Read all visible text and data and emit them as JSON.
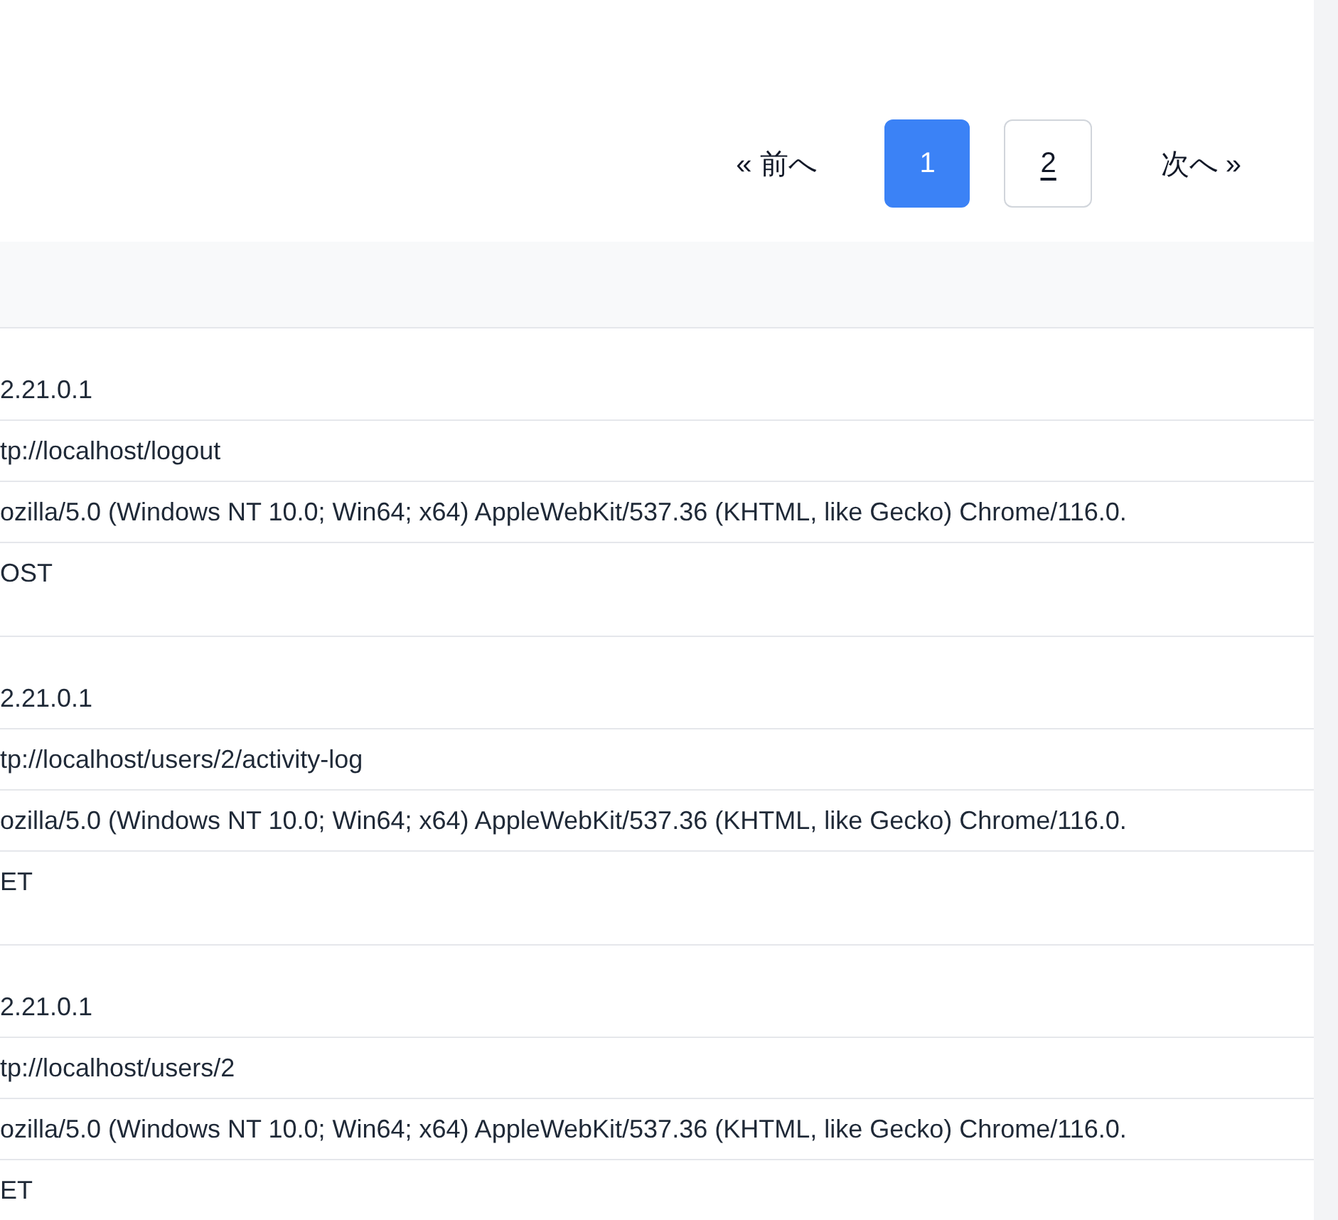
{
  "pagination": [
    {
      "kind": "prev",
      "label": "« 前へ"
    },
    {
      "kind": "page",
      "label": "1",
      "selected": true
    },
    {
      "kind": "page",
      "label": "2",
      "selected": false
    },
    {
      "kind": "next",
      "label": "次へ »"
    }
  ],
  "entries": [
    {
      "ip": "2.21.0.1",
      "url": "tp://localhost/logout",
      "user_agent": "ozilla/5.0 (Windows NT 10.0; Win64; x64) AppleWebKit/537.36 (KHTML, like Gecko) Chrome/116.0.",
      "method": "OST"
    },
    {
      "ip": "2.21.0.1",
      "url": "tp://localhost/users/2/activity-log",
      "user_agent": "ozilla/5.0 (Windows NT 10.0; Win64; x64) AppleWebKit/537.36 (KHTML, like Gecko) Chrome/116.0.",
      "method": "ET"
    },
    {
      "ip": "2.21.0.1",
      "url": "tp://localhost/users/2",
      "user_agent": "ozilla/5.0 (Windows NT 10.0; Win64; x64) AppleWebKit/537.36 (KHTML, like Gecko) Chrome/116.0.",
      "method": "ET"
    }
  ]
}
